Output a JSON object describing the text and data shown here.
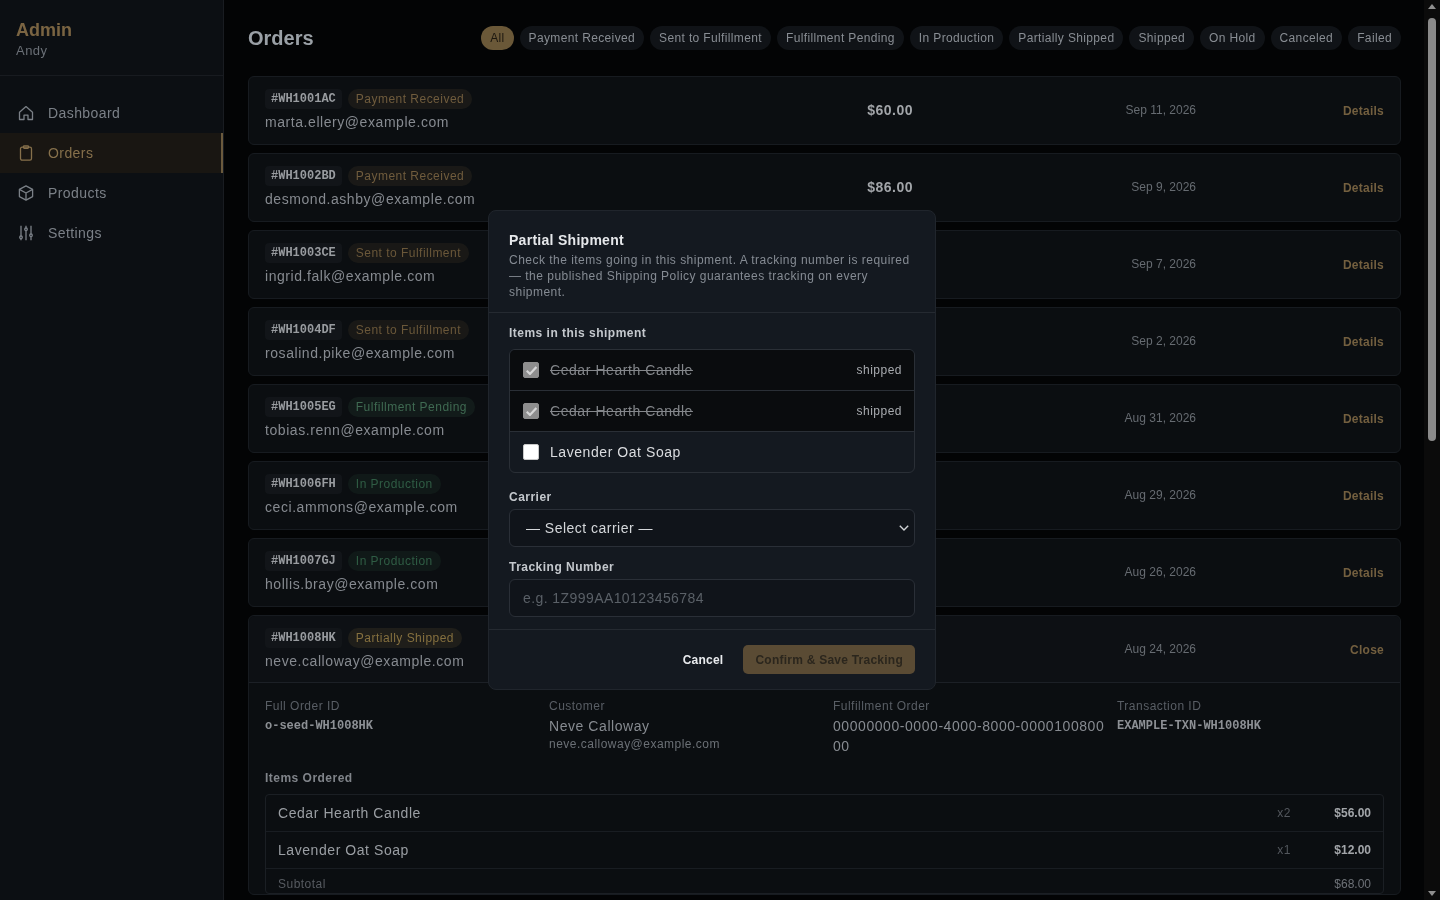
{
  "sidebar": {
    "title": "Admin",
    "user": "Andy",
    "items": [
      {
        "label": "Dashboard",
        "selected": false
      },
      {
        "label": "Orders",
        "selected": true
      },
      {
        "label": "Products",
        "selected": false
      },
      {
        "label": "Settings",
        "selected": false
      }
    ]
  },
  "header": {
    "title": "Orders",
    "filters": [
      {
        "label": "All",
        "selected": true
      },
      {
        "label": "Payment Received",
        "selected": false
      },
      {
        "label": "Sent to Fulfillment",
        "selected": false
      },
      {
        "label": "Fulfillment Pending",
        "selected": false
      },
      {
        "label": "In Production",
        "selected": false
      },
      {
        "label": "Partially Shipped",
        "selected": false
      },
      {
        "label": "Shipped",
        "selected": false
      },
      {
        "label": "On Hold",
        "selected": false
      },
      {
        "label": "Canceled",
        "selected": false
      },
      {
        "label": "Failed",
        "selected": false
      }
    ]
  },
  "orders": [
    {
      "id": "#WH1001AC",
      "status": {
        "label": "Payment Received",
        "color": "#705c3d"
      },
      "email": "marta.ellery@example.com",
      "amount": "$60.00",
      "date": "Sep 11, 2026",
      "action": "Details",
      "expanded": false
    },
    {
      "id": "#WH1002BD",
      "status": {
        "label": "Payment Received",
        "color": "#705c3d"
      },
      "email": "desmond.ashby@example.com",
      "amount": "$86.00",
      "date": "Sep 9, 2026",
      "action": "Details",
      "expanded": false
    },
    {
      "id": "#WH1003CE",
      "status": {
        "label": "Sent to Fulfillment",
        "color": "#6a5739"
      },
      "email": "ingrid.falk@example.com",
      "date": "Sep 7, 2026",
      "action": "Details",
      "expanded": false
    },
    {
      "id": "#WH1004DF",
      "status": {
        "label": "Sent to Fulfillment",
        "color": "#6a5739"
      },
      "email": "rosalind.pike@example.com",
      "date": "Sep 2, 2026",
      "action": "Details",
      "expanded": false
    },
    {
      "id": "#WH1005EG",
      "status": {
        "label": "Fulfillment Pending",
        "color": "#3f6a52"
      },
      "email": "tobias.renn@example.com",
      "date": "Aug 31, 2026",
      "action": "Details",
      "expanded": false
    },
    {
      "id": "#WH1006FH",
      "status": {
        "label": "In Production",
        "color": "#2f5c44"
      },
      "email": "ceci.ammons@example.com",
      "date": "Aug 29, 2026",
      "action": "Details",
      "expanded": false
    },
    {
      "id": "#WH1007GJ",
      "status": {
        "label": "In Production",
        "color": "#2f5c44"
      },
      "email": "hollis.bray@example.com",
      "date": "Aug 26, 2026",
      "action": "Details",
      "expanded": false
    },
    {
      "id": "#WH1008HK",
      "status": {
        "label": "Partially Shipped",
        "color": "#85703f"
      },
      "email": "neve.calloway@example.com",
      "date": "Aug 24, 2026",
      "action": "Close",
      "expanded": true,
      "detail": {
        "fields": [
          {
            "label": "Full Order ID",
            "value": "o-seed-WH1008HK",
            "kind": "code"
          },
          {
            "label": "Customer",
            "value": "Neve Calloway",
            "sub": "neve.calloway@example.com",
            "kind": "text"
          },
          {
            "label": "Fulfillment Order",
            "value": "00000000-0000-4000-8000-000010080000",
            "kind": "text"
          },
          {
            "label": "Transaction ID",
            "value": "EXAMPLE-TXN-WH1008HK",
            "kind": "code"
          }
        ],
        "items_title": "Items Ordered",
        "items": [
          {
            "name": "Cedar Hearth Candle",
            "qty": "x2",
            "price": "$56.00"
          },
          {
            "name": "Lavender Oat Soap",
            "qty": "x1",
            "price": "$12.00"
          }
        ],
        "totals": [
          {
            "label": "Subtotal",
            "value": "$68.00"
          }
        ]
      }
    }
  ],
  "modal": {
    "title": "Partial Shipment",
    "description": "Check the items going in this shipment. A tracking number is required — the published Shipping Policy guarantees tracking on every shipment.",
    "items_title": "Items in this shipment",
    "items": [
      {
        "label": "Cedar Hearth Candle",
        "checked": true,
        "disabled": true,
        "note": "shipped"
      },
      {
        "label": "Cedar Hearth Candle",
        "checked": true,
        "disabled": true,
        "note": "shipped"
      },
      {
        "label": "Lavender Oat Soap",
        "checked": false,
        "disabled": false
      }
    ],
    "carrier": {
      "label": "Carrier",
      "value": "— Select carrier —"
    },
    "tracking": {
      "label": "Tracking Number",
      "placeholder": "e.g. 1Z999AA10123456784"
    },
    "buttons": [
      {
        "label": "Cancel",
        "kind": "secondary",
        "disabled": false
      },
      {
        "label": "Confirm & Save Tracking",
        "kind": "primary",
        "disabled": true
      }
    ]
  }
}
